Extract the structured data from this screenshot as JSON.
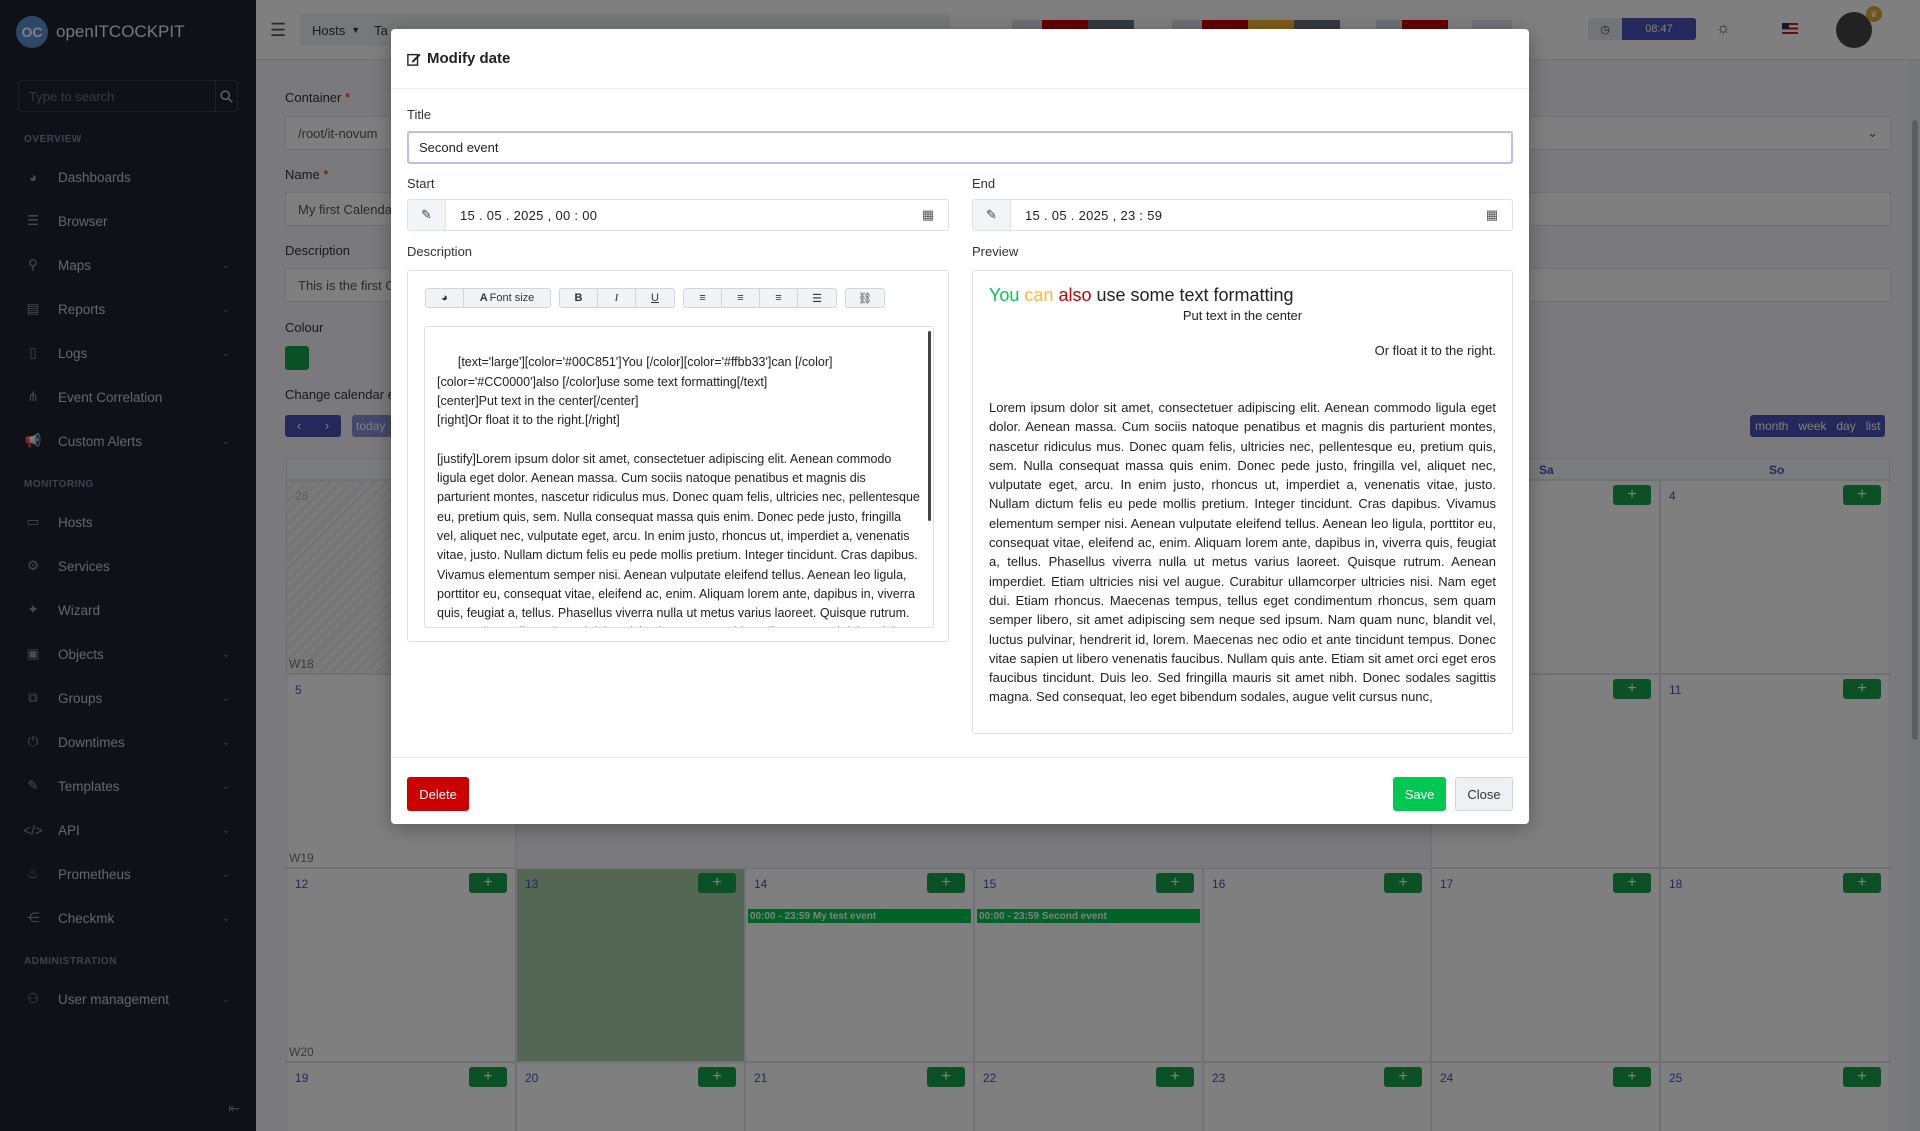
{
  "app": {
    "name": "openITCOCKPIT",
    "logo_letters": "OC"
  },
  "sidebar": {
    "search_placeholder": "Type to search",
    "section_overview": "OVERVIEW",
    "section_monitoring": "MONITORING",
    "section_administration": "ADMINISTRATION",
    "items": [
      {
        "label": "Dashboards",
        "icon": "palette-icon",
        "chevron": false
      },
      {
        "label": "Browser",
        "icon": "list-icon",
        "chevron": false
      },
      {
        "label": "Maps",
        "icon": "map-pin-icon",
        "chevron": true
      },
      {
        "label": "Reports",
        "icon": "report-icon",
        "chevron": true
      },
      {
        "label": "Logs",
        "icon": "file-icon",
        "chevron": true
      },
      {
        "label": "Event Correlation",
        "icon": "sitemap-icon",
        "chevron": false
      },
      {
        "label": "Custom Alerts",
        "icon": "megaphone-icon",
        "chevron": true
      },
      {
        "label": "Hosts",
        "icon": "desktop-icon",
        "chevron": false
      },
      {
        "label": "Services",
        "icon": "gears-icon",
        "chevron": false
      },
      {
        "label": "Wizard",
        "icon": "wand-icon",
        "chevron": false
      },
      {
        "label": "Objects",
        "icon": "cubes-icon",
        "chevron": true
      },
      {
        "label": "Groups",
        "icon": "object-group-icon",
        "chevron": true
      },
      {
        "label": "Downtimes",
        "icon": "power-icon",
        "chevron": true
      },
      {
        "label": "Templates",
        "icon": "edit-icon",
        "chevron": true
      },
      {
        "label": "API",
        "icon": "code-icon",
        "chevron": true
      },
      {
        "label": "Prometheus",
        "icon": "fire-icon",
        "chevron": true
      },
      {
        "label": "Checkmk",
        "icon": "share-icon",
        "chevron": true
      },
      {
        "label": "User management",
        "icon": "users-icon",
        "chevron": true
      }
    ]
  },
  "topbar": {
    "breadcrumb_1": "Hosts",
    "breadcrumb_2": "Ta",
    "clock": "08:47",
    "status_colors": [
      "#cc0000",
      "#6c757d",
      "#cc0000",
      "#ffbb33",
      "#6c757d",
      "#cc0000"
    ]
  },
  "form": {
    "container_label": "Container",
    "container_value": "/root/it-novum",
    "name_label": "Name",
    "name_value": "My first Calenda",
    "description_label": "Description",
    "description_value": "This is the first C",
    "colour_label": "Colour",
    "colour_value": "#00c851",
    "change_calendar_label": "Change calendar e",
    "today_label": "today",
    "views": [
      "month",
      "week",
      "day",
      "list"
    ]
  },
  "calendar": {
    "headers": {
      "sa": "Sa",
      "so": "So"
    },
    "weeks": [
      "W18",
      "W19",
      "W20"
    ],
    "row1": [
      "28",
      "4"
    ],
    "row2": [
      "5",
      "11"
    ],
    "row3": [
      "12",
      "13",
      "14",
      "15",
      "16",
      "17",
      "18"
    ],
    "row4": [
      "19",
      "20",
      "21",
      "22",
      "23",
      "24",
      "25"
    ],
    "events": [
      "00:00 - 23:59 My test event",
      "00:00 - 23:59 Second event"
    ]
  },
  "modal": {
    "title": "Modify date",
    "title_label": "Title",
    "title_value": "Second event",
    "start_label": "Start",
    "start_value": "15 . 05 . 2025 ,  00 : 00",
    "end_label": "End",
    "end_value": "15 . 05 . 2025 ,  23 : 59",
    "description_label": "Description",
    "preview_label": "Preview",
    "toolbar": {
      "font_size": "Font size",
      "bold": "B",
      "italic": "I",
      "underline": "U"
    },
    "description_text": "[text='large'][color='#00C851']You [/color][color='#ffbb33']can [/color]\n[color='#CC0000']also [/color]use some text formatting[/text]\n[center]Put text in the center[/center]\n[right]Or float it to the right.[/right]\n\n[justify]Lorem ipsum dolor sit amet, consectetuer adipiscing elit. Aenean commodo ligula eget dolor. Aenean massa. Cum sociis natoque penatibus et magnis dis parturient montes, nascetur ridiculus mus. Donec quam felis, ultricies nec, pellentesque eu, pretium quis, sem. Nulla consequat massa quis enim. Donec pede justo, fringilla vel, aliquet nec, vulputate eget, arcu. In enim justo, rhoncus ut, imperdiet a, venenatis vitae, justo. Nullam dictum felis eu pede mollis pretium. Integer tincidunt. Cras dapibus. Vivamus elementum semper nisi. Aenean vulputate eleifend tellus. Aenean leo ligula, porttitor eu, consequat vitae, eleifend ac, enim. Aliquam lorem ante, dapibus in, viverra quis, feugiat a, tellus. Phasellus viverra nulla ut metus varius laoreet. Quisque rutrum. Aenean imperdiet. Etiam ultricies nisi vel augue. Curabitur ullamcorper ultricies nisi. Nam eget dui. Etiam rhoncus.",
    "preview": {
      "you": "You",
      "can": "can",
      "also": "also",
      "rest": "use some text formatting",
      "center": "Put text in the center",
      "right": "Or float it to the right.",
      "justify": "Lorem ipsum dolor sit amet, consectetuer adipiscing elit. Aenean commodo ligula eget dolor. Aenean massa. Cum sociis natoque penatibus et magnis dis parturient montes, nascetur ridiculus mus. Donec quam felis, ultricies nec, pellentesque eu, pretium quis, sem. Nulla consequat massa quis enim. Donec pede justo, fringilla vel, aliquet nec, vulputate eget, arcu. In enim justo, rhoncus ut, imperdiet a, venenatis vitae, justo. Nullam dictum felis eu pede mollis pretium. Integer tincidunt. Cras dapibus. Vivamus elementum semper nisi. Aenean vulputate eleifend tellus. Aenean leo ligula, porttitor eu, consequat vitae, eleifend ac, enim. Aliquam lorem ante, dapibus in, viverra quis, feugiat a, tellus. Phasellus viverra nulla ut metus varius laoreet. Quisque rutrum. Aenean imperdiet. Etiam ultricies nisi vel augue. Curabitur ullamcorper ultricies nisi. Nam eget dui. Etiam rhoncus. Maecenas tempus, tellus eget condimentum rhoncus, sem quam semper libero, sit amet adipiscing sem neque sed ipsum. Nam quam nunc, blandit vel, luctus pulvinar, hendrerit id, lorem. Maecenas nec odio et ante tincidunt tempus. Donec vitae sapien ut libero venenatis faucibus. Nullam quis ante. Etiam sit amet orci eget eros faucibus tincidunt. Duis leo. Sed fringilla mauris sit amet nibh. Donec sodales sagittis magna. Sed consequat, leo eget bibendum sodales, augue velit cursus nunc,"
    },
    "delete_label": "Delete",
    "save_label": "Save",
    "close_label": "Close",
    "colors": {
      "green": "#00c851",
      "orange": "#ffbb33",
      "red": "#cc0000",
      "danger_btn": "#cc0000",
      "save_btn": "#00c851"
    }
  }
}
